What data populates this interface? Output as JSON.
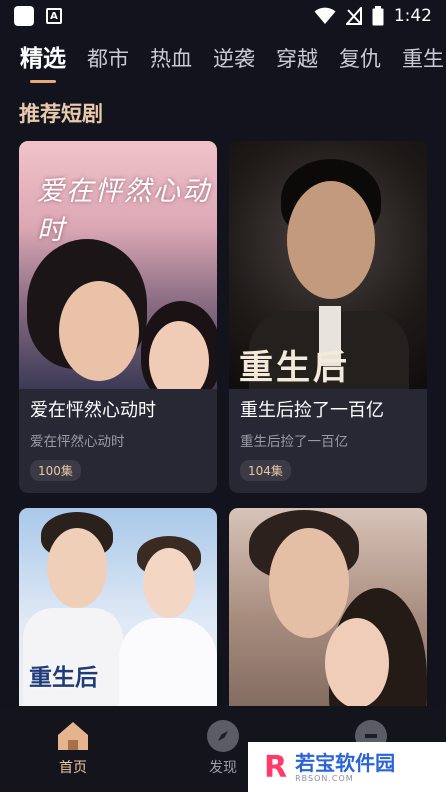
{
  "status_bar": {
    "time": "1:42",
    "notification_letter": "A"
  },
  "tabs": [
    {
      "label": "精选",
      "active": true
    },
    {
      "label": "都市",
      "active": false
    },
    {
      "label": "热血",
      "active": false
    },
    {
      "label": "逆袭",
      "active": false
    },
    {
      "label": "穿越",
      "active": false
    },
    {
      "label": "复仇",
      "active": false
    },
    {
      "label": "重生",
      "active": false
    }
  ],
  "section_title": "推荐短剧",
  "cards": [
    {
      "title": "爱在怦然心动时",
      "subtitle": "爱在怦然心动时",
      "episodes": "100集",
      "poster_text": "爱在怦然心动时"
    },
    {
      "title": "重生后捡了一百亿",
      "subtitle": "重生后捡了一百亿",
      "episodes": "104集",
      "poster_text": "重生后"
    },
    {
      "poster_text": "重生后"
    },
    {}
  ],
  "bottom_nav": [
    {
      "label": "首页",
      "icon": "home-icon",
      "active": true
    },
    {
      "label": "发现",
      "icon": "compass-icon",
      "active": false
    },
    {
      "label": "",
      "icon": "profile-icon",
      "active": false
    }
  ],
  "watermark": {
    "text": "若宝软件园",
    "sub": "RBSON.COM"
  },
  "colors": {
    "background": "#12131c",
    "accent": "#e9a678",
    "card": "#272834",
    "section_title": "#e8c9ab"
  }
}
